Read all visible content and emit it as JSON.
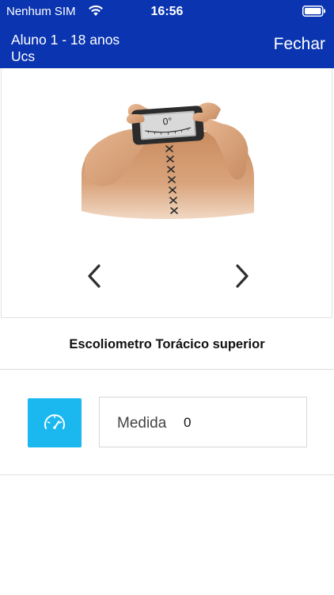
{
  "status_bar": {
    "carrier": "Nenhum SIM",
    "time": "16:56"
  },
  "nav": {
    "title_line1": "Aluno 1 - 18 anos",
    "title_line2": "Ucs",
    "close_label": "Fechar"
  },
  "illustration": {
    "display_reading": "0°"
  },
  "exercise": {
    "title": "Escoliometro Torácico superior"
  },
  "measure": {
    "label": "Medida",
    "value": "0"
  },
  "colors": {
    "header_bg": "#0a34b0",
    "accent": "#1ab8ee"
  },
  "icons": {
    "wifi": "wifi-icon",
    "battery": "battery-icon",
    "prev": "chevron-left-icon",
    "next": "chevron-right-icon",
    "measure": "speedometer-icon"
  }
}
